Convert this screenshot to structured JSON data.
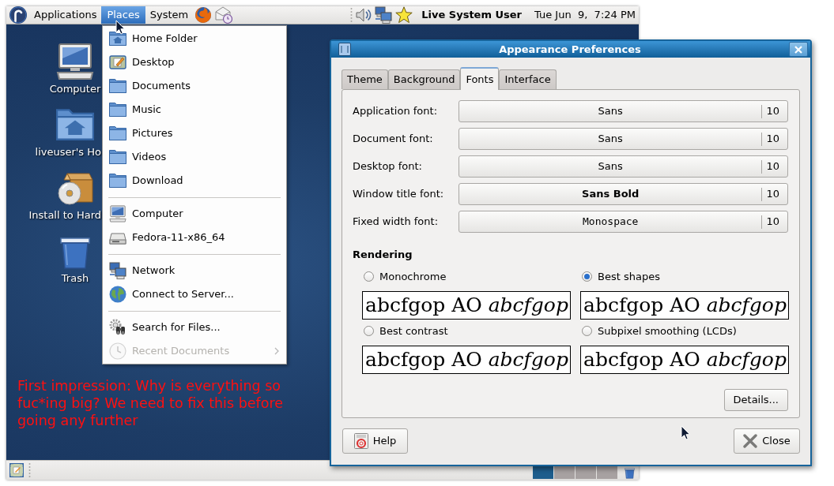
{
  "top_panel": {
    "menus": [
      {
        "label": "Applications",
        "selected": false
      },
      {
        "label": "Places",
        "selected": true
      },
      {
        "label": "System",
        "selected": false
      }
    ],
    "user": "Live System User",
    "clock": "Tue Jun  9,  7:24 PM"
  },
  "desktop": {
    "icons": [
      {
        "label": "Computer"
      },
      {
        "label": "liveuser's Ho"
      },
      {
        "label": "Install to Hard"
      },
      {
        "label": "Trash"
      }
    ],
    "annotation": "First impression: Why is everything so fuc*ing big? We need to fix this before going any further"
  },
  "places_menu": {
    "sections": [
      {
        "items": [
          {
            "label": "Home Folder",
            "disabled": false,
            "submenu": false
          },
          {
            "label": "Desktop",
            "disabled": false,
            "submenu": false
          },
          {
            "label": "Documents",
            "disabled": false,
            "submenu": false
          },
          {
            "label": "Music",
            "disabled": false,
            "submenu": false
          },
          {
            "label": "Pictures",
            "disabled": false,
            "submenu": false
          },
          {
            "label": "Videos",
            "disabled": false,
            "submenu": false
          },
          {
            "label": "Download",
            "disabled": false,
            "submenu": false
          }
        ]
      },
      {
        "items": [
          {
            "label": "Computer",
            "disabled": false,
            "submenu": false
          },
          {
            "label": "Fedora-11-x86_64",
            "disabled": false,
            "submenu": false
          }
        ]
      },
      {
        "items": [
          {
            "label": "Network",
            "disabled": false,
            "submenu": false
          },
          {
            "label": "Connect to Server...",
            "disabled": false,
            "submenu": false
          }
        ]
      },
      {
        "items": [
          {
            "label": "Search for Files...",
            "disabled": false,
            "submenu": false
          },
          {
            "label": "Recent Documents",
            "disabled": true,
            "submenu": true
          }
        ]
      }
    ]
  },
  "dialog": {
    "title": "Appearance Preferences",
    "tabs": [
      {
        "label": "Theme",
        "selected": false
      },
      {
        "label": "Background",
        "selected": false
      },
      {
        "label": "Fonts",
        "selected": true
      },
      {
        "label": "Interface",
        "selected": false
      }
    ],
    "fonts": [
      {
        "label": "Application font:",
        "font": "Sans",
        "kind": "regular",
        "size": "10"
      },
      {
        "label": "Document font:",
        "font": "Sans",
        "kind": "regular",
        "size": "10"
      },
      {
        "label": "Desktop font:",
        "font": "Sans",
        "kind": "regular",
        "size": "10"
      },
      {
        "label": "Window title font:",
        "font": "Sans Bold",
        "kind": "bold",
        "size": "10"
      },
      {
        "label": "Fixed width font:",
        "font": "Monospace",
        "kind": "monospace",
        "size": "10"
      }
    ],
    "rendering": {
      "heading": "Rendering",
      "options": [
        {
          "label": "Monochrome",
          "selected": false,
          "sample": "abcfgop AO *abcfgop*"
        },
        {
          "label": "Best shapes",
          "selected": true,
          "sample": "abcfgop AO *abcfgop*"
        },
        {
          "label": "Best contrast",
          "selected": false,
          "sample": "abcfgop AO *abcfgop*"
        },
        {
          "label": "Subpixel smoothing (LCDs)",
          "selected": false,
          "sample": "abcfgop AO *abcfgop*"
        }
      ]
    },
    "details_button": "Details...",
    "help_button": "Help",
    "close_button": "Close"
  },
  "bottom_panel": {
    "workspaces": [
      {
        "selected": true
      },
      {
        "selected": false
      },
      {
        "selected": false
      },
      {
        "selected": false
      }
    ]
  }
}
